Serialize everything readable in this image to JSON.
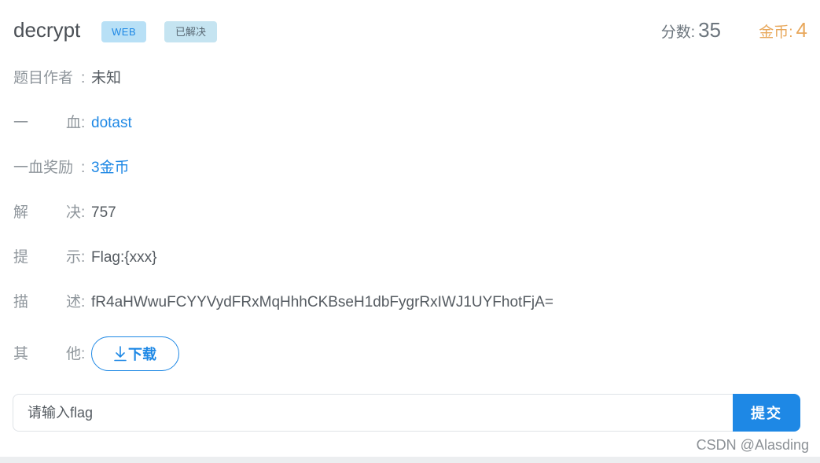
{
  "challenge": {
    "title": "decrypt",
    "category_tag": "WEB",
    "status_tag": "已解决",
    "score_label": "分数:",
    "score_value": "35",
    "coins_label": "金币:",
    "coins_value": "4"
  },
  "details": [
    {
      "label_chars": [
        "题目作者"
      ],
      "colon": ":",
      "value": "未知"
    },
    {
      "label_chars": [
        "一",
        "血"
      ],
      "colon": ":",
      "value": "dotast"
    },
    {
      "label_chars": [
        "一血奖励"
      ],
      "colon": ":",
      "value": "3金币"
    },
    {
      "label_chars": [
        "解",
        "决"
      ],
      "colon": ":",
      "value": "757"
    },
    {
      "label_chars": [
        "提",
        "示"
      ],
      "colon": ":",
      "value": "Flag:{xxx}"
    },
    {
      "label_chars": [
        "描",
        "述"
      ],
      "colon": ":",
      "value": "fR4aHWwuFCYYVydFRxMqHhhCKBseH1dbFygrRxIWJ1UYFhotFjA="
    },
    {
      "label_chars": [
        "其",
        "他"
      ],
      "colon": ":"
    }
  ],
  "download_button": {
    "label": "下载",
    "icon": "download-arrow-icon"
  },
  "flag_form": {
    "placeholder": "请输入flag",
    "submit_label": "提交"
  },
  "watermark": "CSDN @Alasding",
  "colors": {
    "accent": "#1e88e5",
    "coins": "#e8a85c",
    "tag_bg": "#b8e0f6"
  }
}
